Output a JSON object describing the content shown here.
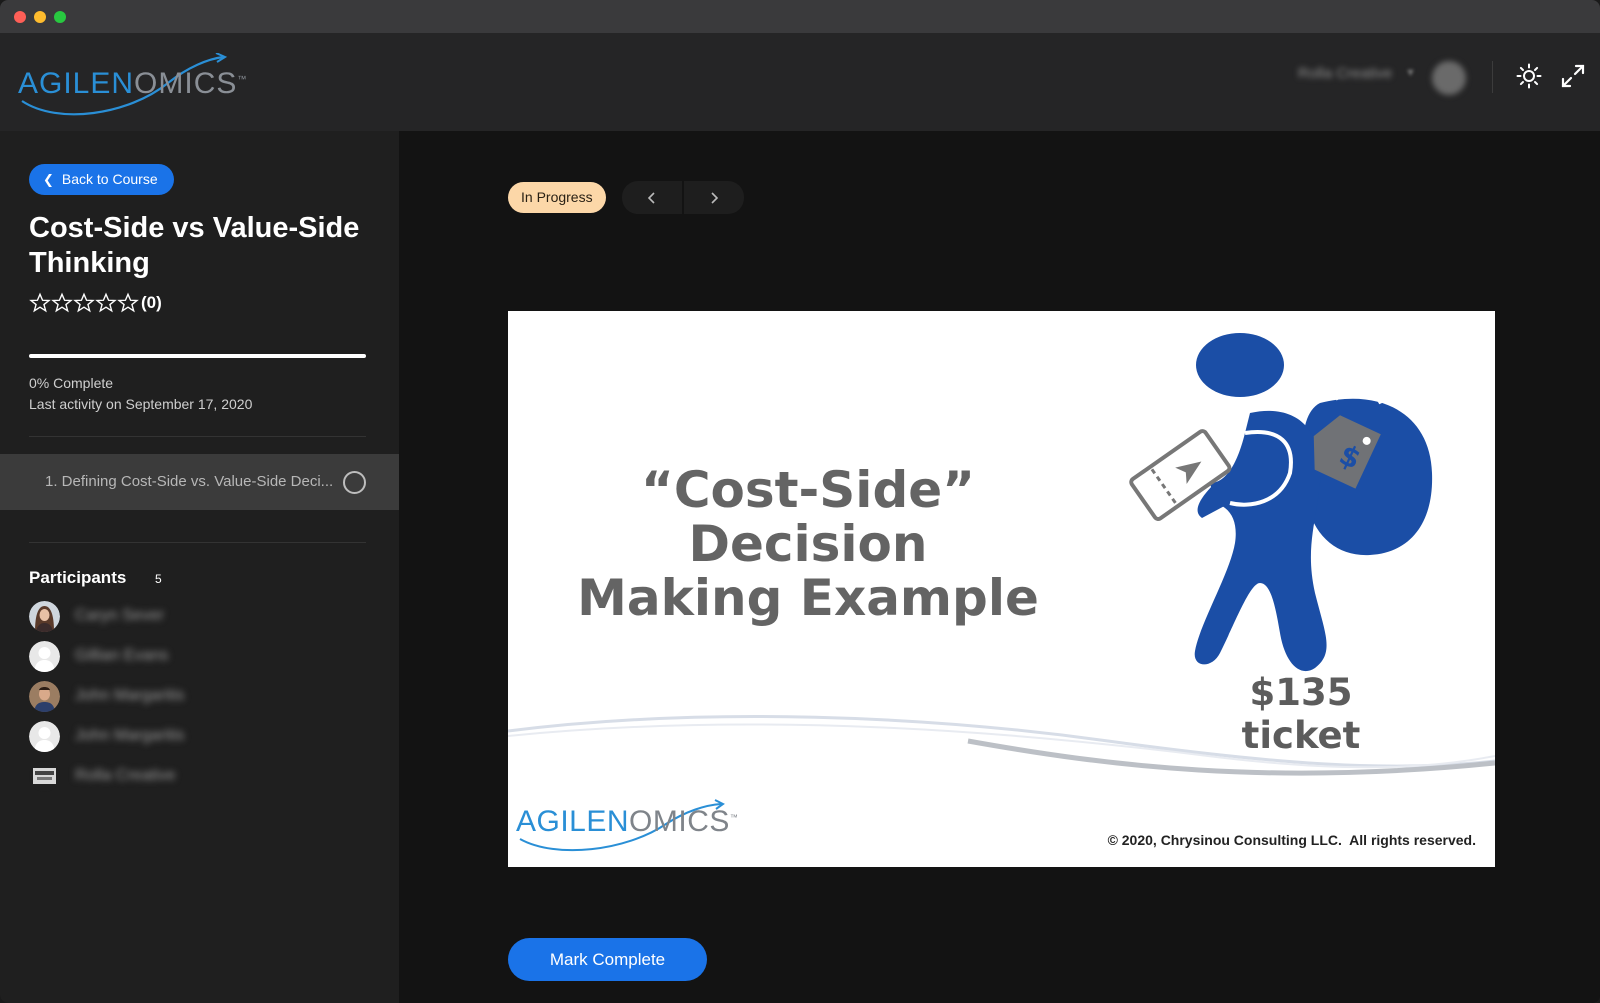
{
  "app": {
    "logo": {
      "part1": "AGILEN",
      "part2": "MICS",
      "tm": "™"
    },
    "user_name": "Rolla Creative"
  },
  "sidebar": {
    "back_label": "Back to Course",
    "course_title": "Cost-Side vs Value-Side Thinking",
    "rating": {
      "stars": 0,
      "max": 5,
      "count_label": "(0)"
    },
    "progress": {
      "percent": 0,
      "complete_label": "0% Complete",
      "activity_label": "Last activity on September 17, 2020"
    },
    "lessons": [
      {
        "label": "1. Defining Cost-Side vs. Value-Side Deci...",
        "completed": false
      }
    ],
    "participants": {
      "label": "Participants",
      "count": "5",
      "people": [
        {
          "name": "Caryn Sever",
          "avatar": "photo-woman"
        },
        {
          "name": "Gillian Evans",
          "avatar": "default"
        },
        {
          "name": "John Margaritis",
          "avatar": "photo-man"
        },
        {
          "name": "John Margaritis",
          "avatar": "default"
        },
        {
          "name": "Rolla Creative",
          "avatar": "logo"
        }
      ]
    }
  },
  "main": {
    "status": "In Progress",
    "slide": {
      "title_line1": "“Cost-Side” Decision",
      "title_line2": "Making Example",
      "caption": "$135 ticket",
      "logo": {
        "part1": "AGILEN",
        "part2": "MICS",
        "tm": "™"
      },
      "copyright": "© 2020, Chrysinou Consulting LLC.  All rights reserved."
    },
    "mark_complete_label": "Mark Complete"
  },
  "colors": {
    "accent": "#1a73e8",
    "status_badge_bg": "#fcd7a8",
    "figure_blue": "#1b4ea6",
    "logo_blue": "#2a8fd6"
  },
  "icons": {
    "back": "chevron-left-icon",
    "theme": "sun-icon",
    "fullscreen": "expand-icon",
    "prev": "chevron-left-icon",
    "next": "chevron-right-icon"
  }
}
